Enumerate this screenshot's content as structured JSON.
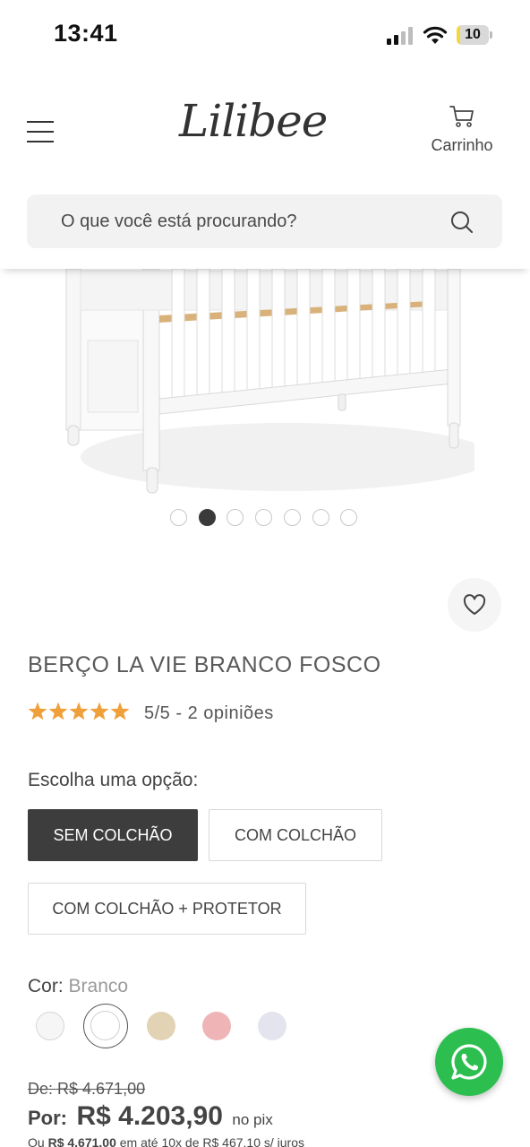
{
  "status_bar": {
    "time": "13:41",
    "battery": "10",
    "battery_level": 0.1
  },
  "header": {
    "logo": "Lilibee",
    "cart_label": "Carrinho",
    "search_placeholder": "O que você está procurando?"
  },
  "gallery": {
    "dot_count": 7,
    "active_index": 1
  },
  "product": {
    "title": "BERÇO LA VIE BRANCO FOSCO",
    "rating": 5,
    "rating_max": 5,
    "rating_text": "5/5 - 2 opiniões",
    "star_color": "#f0a03a"
  },
  "options": {
    "label": "Escolha uma opção:",
    "items": [
      "SEM COLCHÃO",
      "COM COLCHÃO",
      "COM COLCHÃO + PROTETOR"
    ],
    "selected": "SEM COLCHÃO"
  },
  "color": {
    "label": "Cor:",
    "selected": "Branco",
    "swatches": [
      "#f6f6f6",
      "#ffffff",
      "#e3d3b5",
      "#efb4b6",
      "#e4e4ee"
    ]
  },
  "pricing": {
    "old_price": "De: R$ 4.671,00",
    "price_prefix": "Por:",
    "price": "R$ 4.203,90",
    "price_suffix": "no pix",
    "installments_prefix": "Ou",
    "installments_total": "R$ 4.671,00",
    "installments_text": "em até 10x de R$ 467,10 s/ juros"
  },
  "colors": {
    "accent": "#3d3d3d",
    "whatsapp": "#2cbf4f"
  }
}
